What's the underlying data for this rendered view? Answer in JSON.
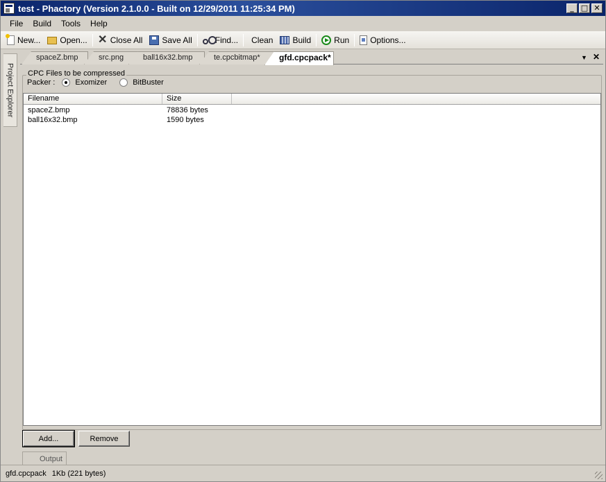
{
  "window": {
    "title": "test - Phactory (Version 2.1.0.0 - Built on 12/29/2011 11:25:34 PM)",
    "controls": [
      "minimize",
      "maximize",
      "close"
    ]
  },
  "menu": [
    "File",
    "Build",
    "Tools",
    "Help"
  ],
  "toolbar": {
    "new": "New...",
    "open": "Open...",
    "close_all": "Close All",
    "save_all": "Save All",
    "find": "Find...",
    "clean": "Clean",
    "build": "Build",
    "run": "Run",
    "options": "Options..."
  },
  "side_panel": {
    "label": "Project Explorer"
  },
  "doc_tabs": [
    {
      "label": "spaceZ.bmp",
      "active": false
    },
    {
      "label": "src.png",
      "active": false
    },
    {
      "label": "ball16x32.bmp",
      "active": false
    },
    {
      "label": "te.cpcbitmap*",
      "active": false
    },
    {
      "label": "gfd.cpcpack*",
      "active": true
    }
  ],
  "tab_controls": {
    "dropdown": "▼",
    "close": "✕"
  },
  "group": {
    "title": "CPC Files to be compressed",
    "packer_label": "Packer :",
    "packer_options": [
      {
        "label": "Exomizer",
        "checked": true
      },
      {
        "label": "BitBuster",
        "checked": false
      }
    ]
  },
  "file_list": {
    "columns": [
      "Filename",
      "Size",
      ""
    ],
    "rows": [
      {
        "filename": "spaceZ.bmp",
        "size": "78836 bytes"
      },
      {
        "filename": "ball16x32.bmp",
        "size": "1590 bytes"
      }
    ]
  },
  "buttons": {
    "add": "Add...",
    "remove": "Remove"
  },
  "output_tab": {
    "label": "Output"
  },
  "status": {
    "file": "gfd.cpcpack",
    "size": "1Kb (221 bytes)"
  }
}
